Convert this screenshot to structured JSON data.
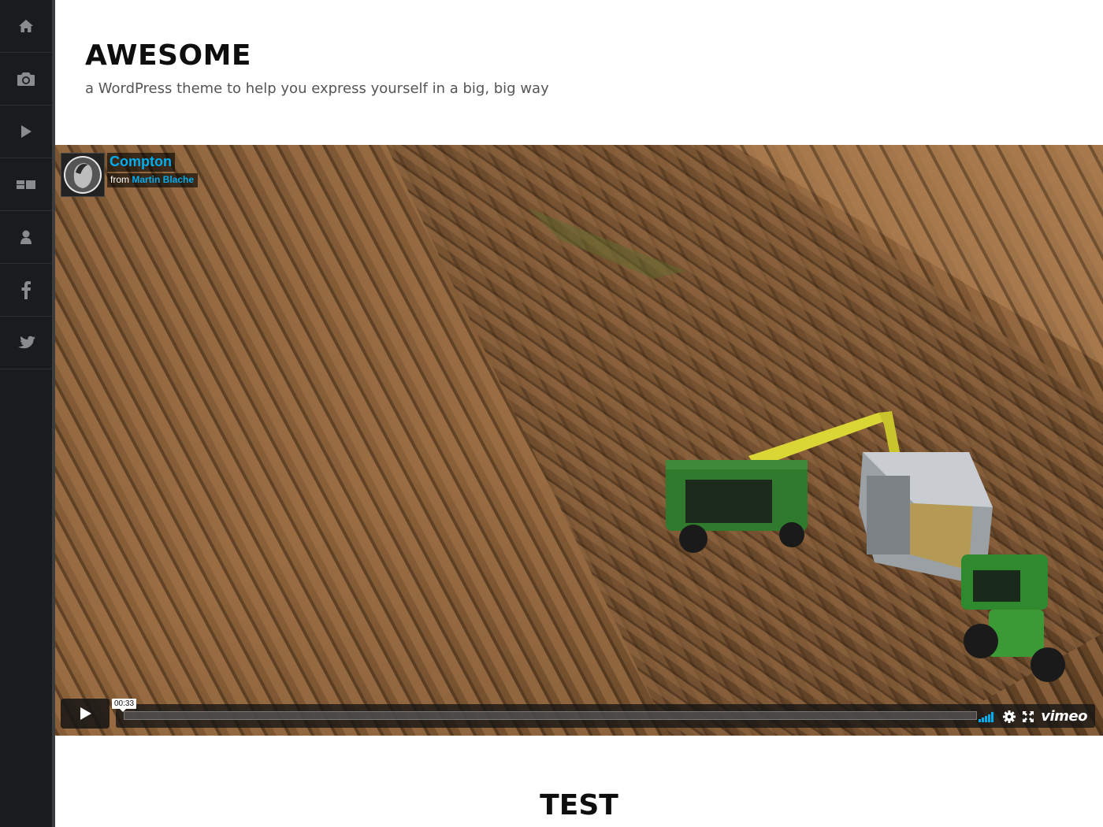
{
  "sidebar": {
    "items": [
      {
        "icon": "home-icon"
      },
      {
        "icon": "camera-icon"
      },
      {
        "icon": "play-icon"
      },
      {
        "icon": "gallery-icon"
      },
      {
        "icon": "user-icon"
      },
      {
        "icon": "facebook-icon"
      },
      {
        "icon": "twitter-icon"
      }
    ]
  },
  "header": {
    "title": "AWESOME",
    "description": "a WordPress theme to help you express yourself in a big, big way"
  },
  "video": {
    "title": "Compton",
    "from_label": "from",
    "author": "Martin Blache",
    "timecode": "00:33",
    "logo": "vimeo",
    "progress": 0.0
  },
  "post": {
    "title": "TEST"
  },
  "colors": {
    "sidebar": "#1a1b1c",
    "accent": "#00adef"
  }
}
